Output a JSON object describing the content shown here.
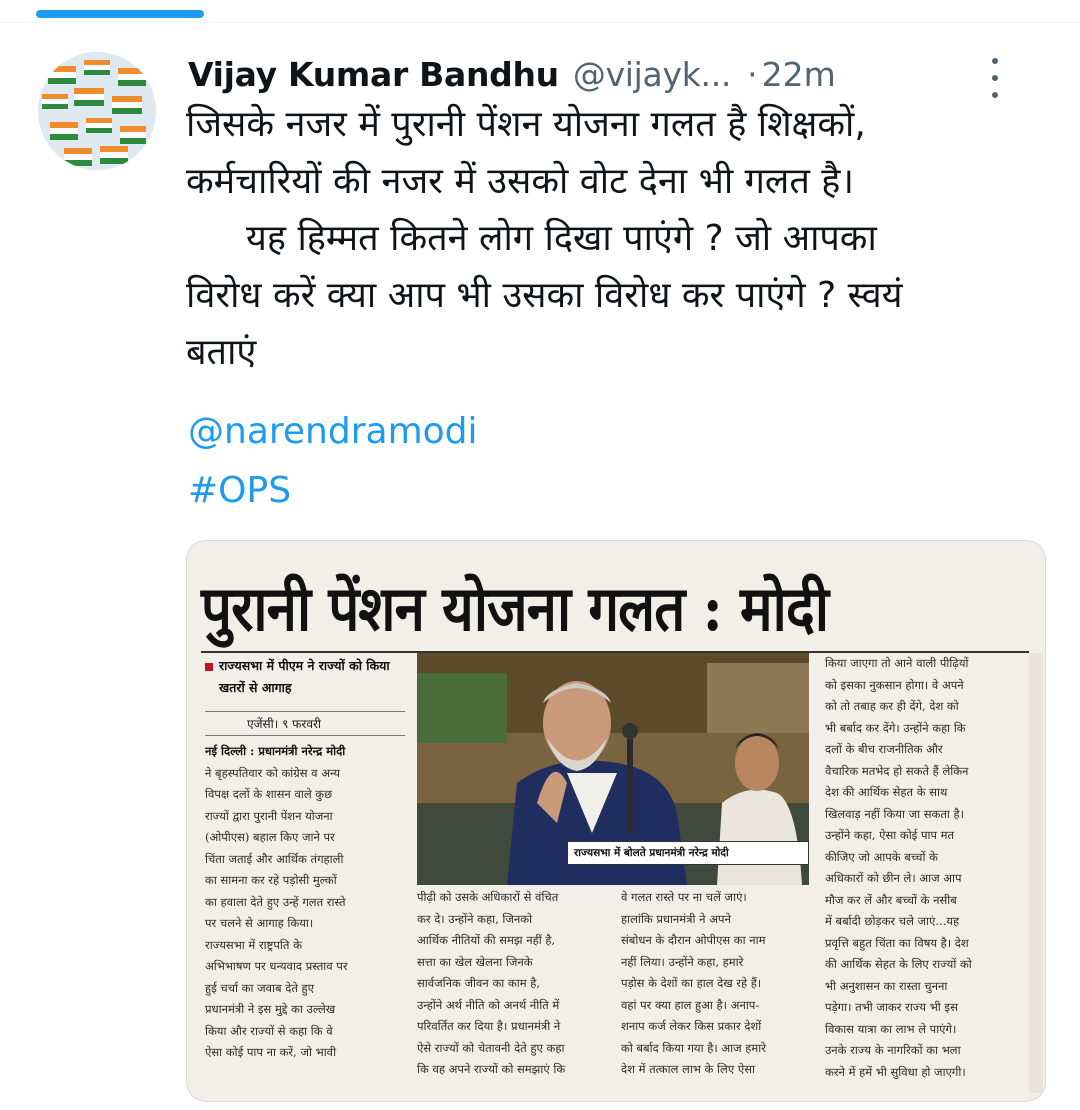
{
  "tweet": {
    "author_name": "Vijay Kumar Bandhu",
    "author_handle": "@vijayk...",
    "separator": "·",
    "time": "22m",
    "lines": [
      "जिसके नजर में पुरानी पेंशन योजना गलत है शिक्षकों,",
      "कर्मचारियों की नजर में उसको वोट देना भी गलत है।",
      "यह हिम्मत कितने लोग दिखा पाएंगे ? जो आपका",
      "विरोध करें क्या आप भी उसका विरोध कर पाएंगे ? स्वयं",
      "बताएं"
    ],
    "mention": "@narendramodi",
    "hashtag": "#OPS",
    "accent_color": "#1d9bf0",
    "avatar_icon": "flags-avatar"
  },
  "newspaper": {
    "headline": "पुरानी पेंशन योजना गलत : मोदी",
    "subhead": "राज्यसभा में पीएम ने राज्यों को किया खतरों से आगाह",
    "dateline": "एजेंसी। ९ फरवरी",
    "photo_caption": "राज्यसभा में बोलते प्रधानमंत्री नरेन्द्र मोदी",
    "col1": [
      "नई दिल्ली : प्रधानमंत्री नरेन्द्र मोदी",
      "ने बृहस्पतिवार को कांग्रेस व अन्य",
      "विपक्ष दलों के शासन वाले कुछ",
      "राज्यों द्वारा पुरानी पेंशन योजना",
      "(ओपीएस) बहाल किए जाने पर",
      "चिंता जताई और आर्थिक तंगहाली",
      "का सामना कर रहे पड़ोसी मुल्कों",
      "का हवाला देते हुए उन्हें गलत रास्ते",
      "पर चलने से आगाह किया।",
      "राज्यसभा में राष्ट्रपति के",
      "अभिभाषण पर धन्यवाद प्रस्ताव पर",
      "हुई चर्चा का जवाब देते हुए",
      "प्रधानमंत्री ने इस मुद्दे का उल्लेख",
      "किया और राज्यों से कहा कि वे",
      "ऐसा कोई पाप ना करें, जो भावी"
    ],
    "col2": [
      "पीढ़ी को उसके अधिकारों से वंचित",
      "कर दे। उन्होंने कहा, जिनको",
      "आर्थिक नीतियों की समझ नहीं है,",
      "सत्ता का खेल खेलना जिनके",
      "सार्वजनिक जीवन का काम है,",
      "उन्होंने अर्थ नीति को अनर्थ नीति में",
      "परिवर्तित कर दिया है। प्रधानमंत्री ने",
      "ऐसे राज्यों को चेतावनी देते हुए कहा",
      "कि वह अपने राज्यों को समझाएं कि"
    ],
    "col3": [
      "वे गलत रास्ते पर ना चलें जाएं।",
      "हालांकि प्रधानमंत्री ने अपने",
      "संबोधन के दौरान ओपीएस का नाम",
      "नहीं लिया। उन्होंने कहा, हमारे",
      "पड़ोस के देशों का हाल देख रहे हैं।",
      "वहां पर क्या हाल हुआ है। अनाप-",
      "शनाप कर्ज लेकर किस प्रकार देशों",
      "को बर्बाद किया गया है। आज हमारे",
      "देश में तत्काल लाभ के लिए ऐसा"
    ],
    "col4": [
      "किया जाएगा तो आने वाली पीढ़ियों",
      "को इसका नुकसान होगा। वे अपने",
      "को तो तबाह कर ही देंगे, देश को",
      "भी बर्बाद कर देंगे। उन्होंने कहा कि",
      "दलों के बीच राजनीतिक और",
      "वैचारिक मतभेद हो सकते हैं लेकिन",
      "देश की आर्थिक सेहत के साथ",
      "खिलवाड़ नहीं किया जा सकता है।",
      "उन्होंने कहा, ऐसा कोई पाप मत",
      "कीजिए जो आपके बच्चों के",
      "अधिकारों को छीन ले। आज आप",
      "मौज कर लें और बच्चों के नसीब",
      "में बर्बादी छोड़कर चले जाएं...यह",
      "प्रवृत्ति बहुत चिंता का विषय है। देश",
      "की आर्थिक सेहत के लिए राज्यों को",
      "भी अनुशासन का रास्ता चुनना",
      "पड़ेगा। तभी जाकर राज्य भी इस",
      "विकास यात्रा का लाभ ले पाएंगे।",
      "उनके राज्य के नागरिकों का भला",
      "करने में हमें भी सुविधा हो जाएगी।"
    ]
  }
}
